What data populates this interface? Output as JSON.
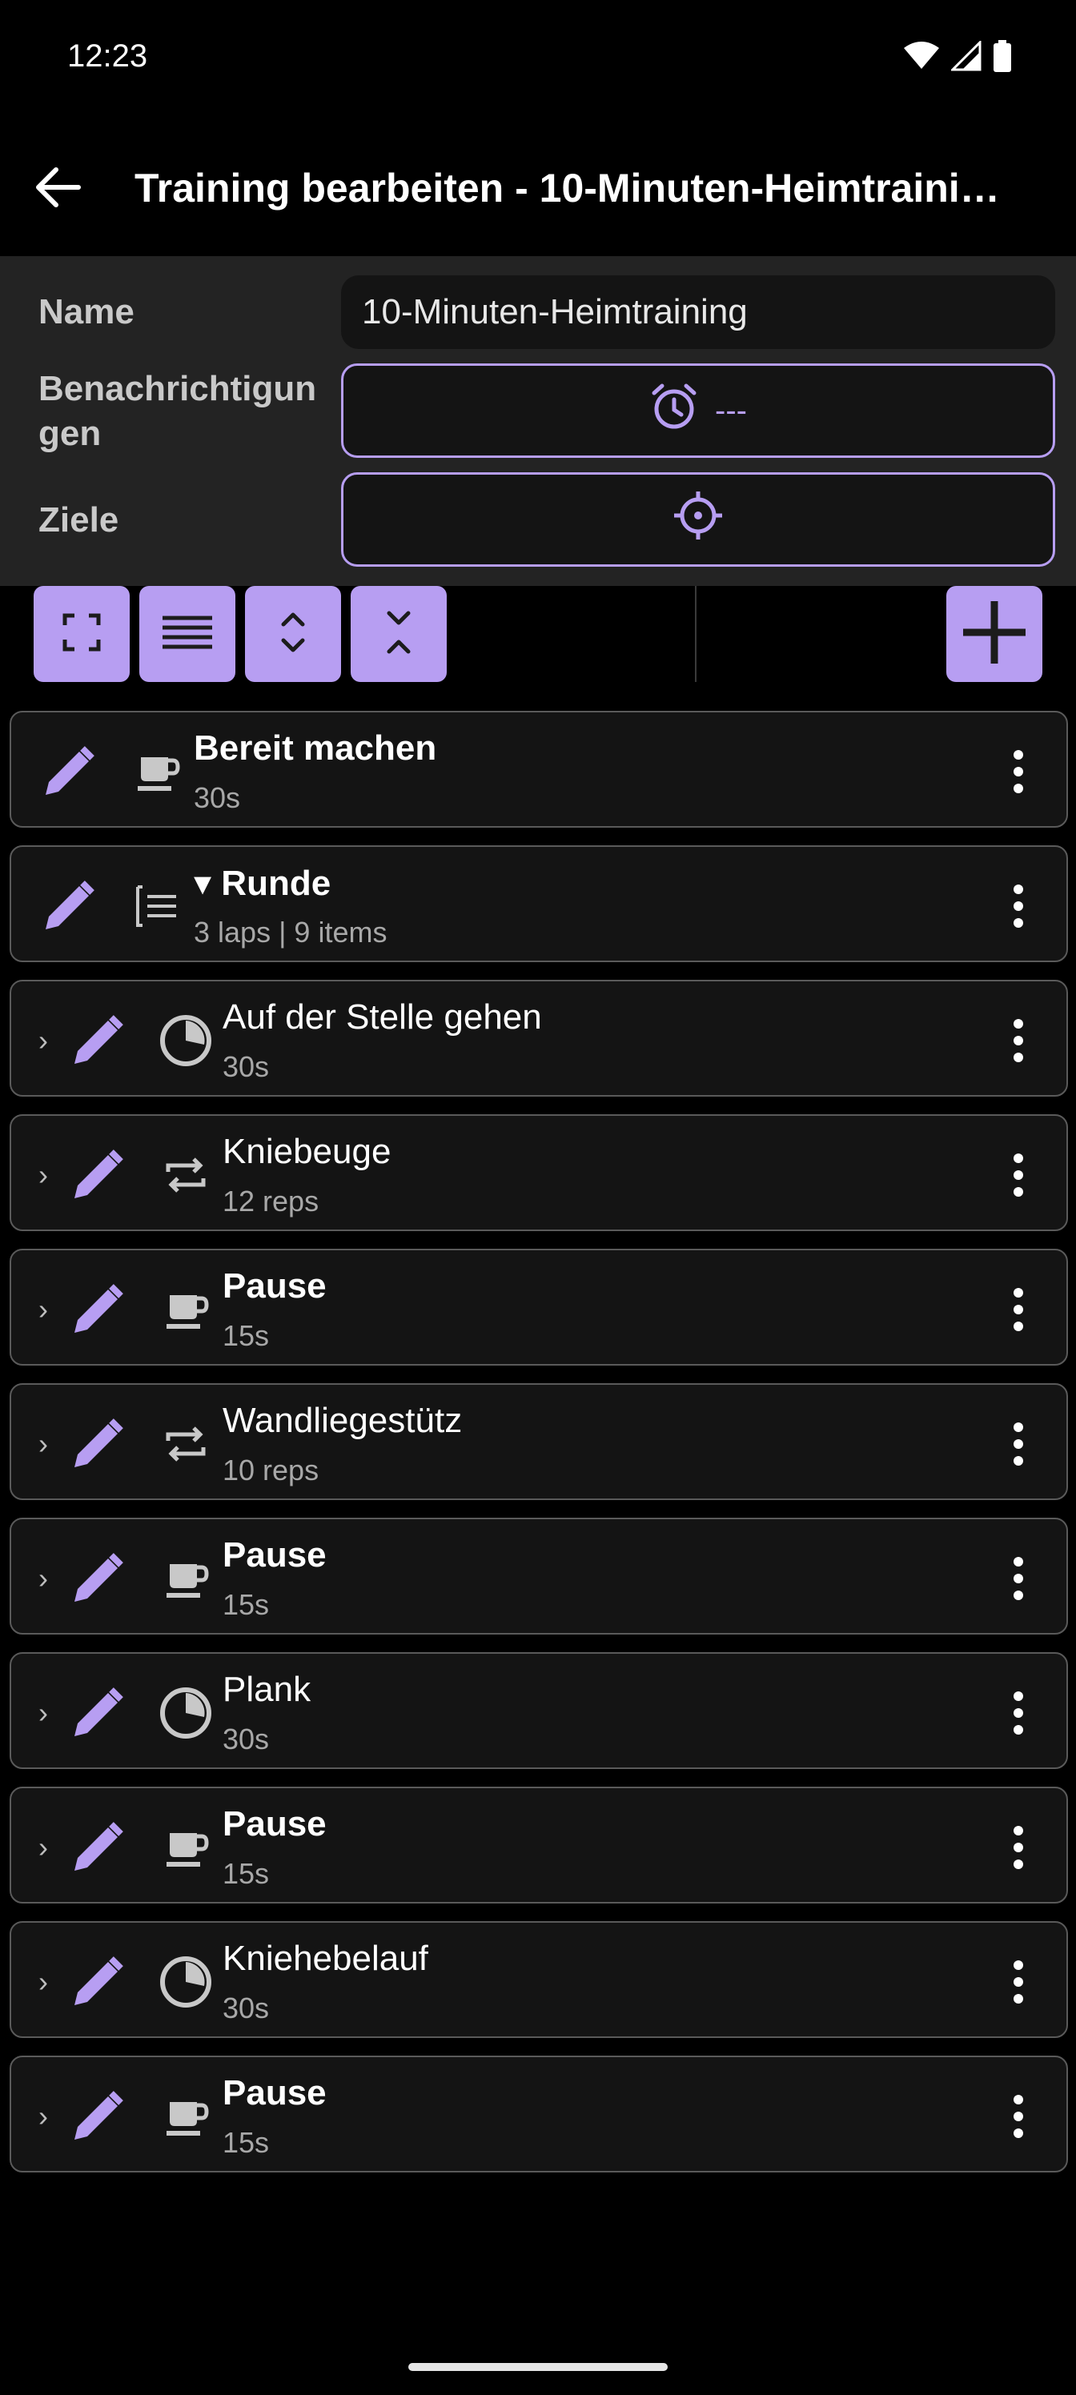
{
  "status_bar": {
    "time": "12:23",
    "icons": [
      "wifi-icon",
      "signal-icon",
      "battery-icon"
    ]
  },
  "app_bar": {
    "back_icon": "arrow-left-icon",
    "title": "Training bearbeiten - 10-Minuten-Heimtraini…"
  },
  "form": {
    "name_label": "Name",
    "name_value": "10-Minuten-Heimtraining",
    "notifications_label": "Benachrichtigun gen",
    "notifications_value": "---",
    "notifications_icon": "alarm-clock-icon",
    "goals_label": "Ziele",
    "goals_icon": "crosshair-icon"
  },
  "toolbar": {
    "buttons": [
      "expand-icon",
      "list-icon",
      "expand-all-icon",
      "collapse-all-icon"
    ],
    "add_icon": "plus-icon"
  },
  "colors": {
    "accent": "#b79ef2",
    "surface": "#141414",
    "panel": "#232323",
    "border": "#5a5a5a"
  },
  "items": [
    {
      "title": "Bereit machen",
      "sub": "30s",
      "icon": "coffee-cup-icon",
      "bold": true,
      "indent": false
    },
    {
      "title": "▾ Runde",
      "sub": "3 laps | 9 items",
      "icon": "nested-list-icon",
      "bold": true,
      "indent": false
    },
    {
      "title": "Auf der Stelle gehen",
      "sub": "30s",
      "icon": "timer-pie-icon",
      "bold": false,
      "indent": true
    },
    {
      "title": "Kniebeuge",
      "sub": "12 reps",
      "icon": "repeat-icon",
      "bold": false,
      "indent": true
    },
    {
      "title": "Pause",
      "sub": "15s",
      "icon": "coffee-cup-icon",
      "bold": true,
      "indent": true
    },
    {
      "title": "Wandliegestütz",
      "sub": "10 reps",
      "icon": "repeat-icon",
      "bold": false,
      "indent": true
    },
    {
      "title": "Pause",
      "sub": "15s",
      "icon": "coffee-cup-icon",
      "bold": true,
      "indent": true
    },
    {
      "title": "Plank",
      "sub": "30s",
      "icon": "timer-pie-icon",
      "bold": false,
      "indent": true
    },
    {
      "title": "Pause",
      "sub": "15s",
      "icon": "coffee-cup-icon",
      "bold": true,
      "indent": true
    },
    {
      "title": "Kniehebelauf",
      "sub": "30s",
      "icon": "timer-pie-icon",
      "bold": false,
      "indent": true
    },
    {
      "title": "Pause",
      "sub": "15s",
      "icon": "coffee-cup-icon",
      "bold": true,
      "indent": true
    }
  ]
}
